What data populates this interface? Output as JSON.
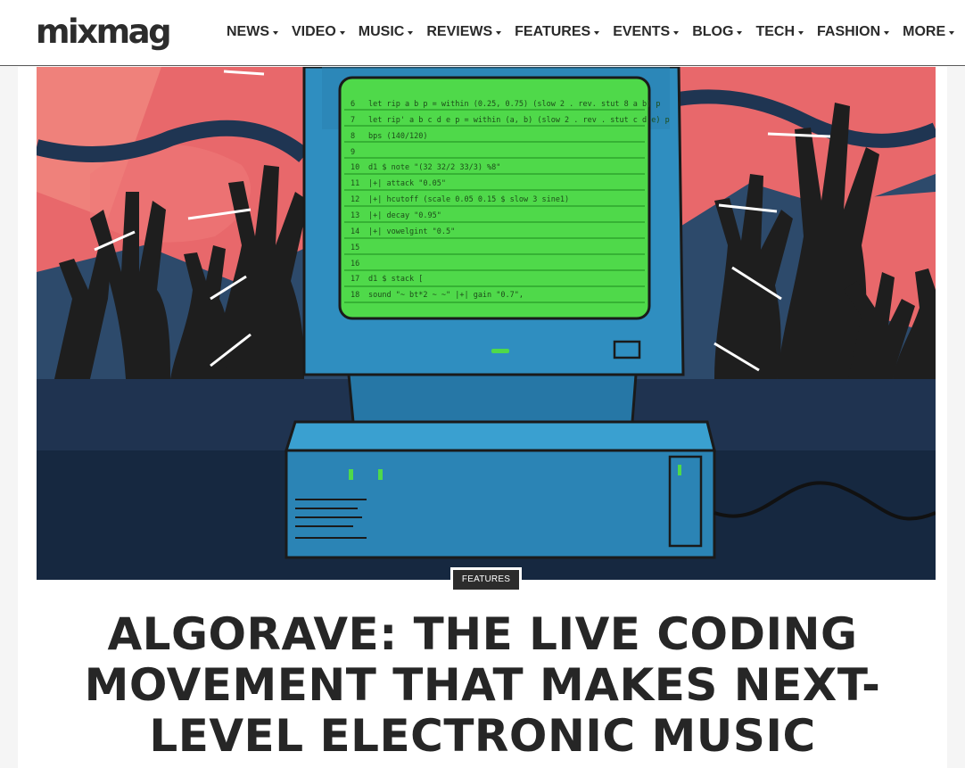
{
  "site": {
    "logo_text": "mixmag",
    "nav": [
      {
        "label": "NEWS"
      },
      {
        "label": "VIDEO"
      },
      {
        "label": "MUSIC"
      },
      {
        "label": "REVIEWS"
      },
      {
        "label": "FEATURES"
      },
      {
        "label": "EVENTS"
      },
      {
        "label": "BLOG"
      },
      {
        "label": "TECH"
      },
      {
        "label": "FASHION"
      },
      {
        "label": "MORE"
      }
    ]
  },
  "article": {
    "category": "FEATURES",
    "title": "ALGORAVE: THE LIVE CODING MOVEMENT THAT MAKES NEXT-LEVEL ELECTRONIC MUSIC",
    "hero_image": {
      "screen_lines": [
        {
          "n": "6",
          "code": "let rip a b p = within (0.25, 0.75) (slow 2 . rev. stut 8 a b) p"
        },
        {
          "n": "7",
          "code": "let rip' a b c d e p = within (a, b) (slow 2 . rev . stut c d e) p"
        },
        {
          "n": "8",
          "code": "bps (140/120)"
        },
        {
          "n": "9",
          "code": ""
        },
        {
          "n": "10",
          "code": "d1 $ note \"(32 32/2 33/3) %8\""
        },
        {
          "n": "11",
          "code": "|+| attack \"0.05\""
        },
        {
          "n": "12",
          "code": "|+| hcutoff (scale 0.05 0.15 $ slow 3 sine1)"
        },
        {
          "n": "13",
          "code": "|+| decay \"0.95\""
        },
        {
          "n": "14",
          "code": "|+| vowelgint \"0.5\""
        },
        {
          "n": "15",
          "code": ""
        },
        {
          "n": "16",
          "code": ""
        },
        {
          "n": "17",
          "code": "d1 $ stack ["
        },
        {
          "n": "18",
          "code": "sound \"~ bt*2 ~ ~\" |+| gain \"0.7\","
        }
      ],
      "colors": {
        "background": "#2d4a6b",
        "accent_red": "#e8686b",
        "screen_green": "#4fd94a",
        "monitor_blue": "#2f8ec0",
        "silhouette": "#1e1e1e"
      }
    }
  }
}
